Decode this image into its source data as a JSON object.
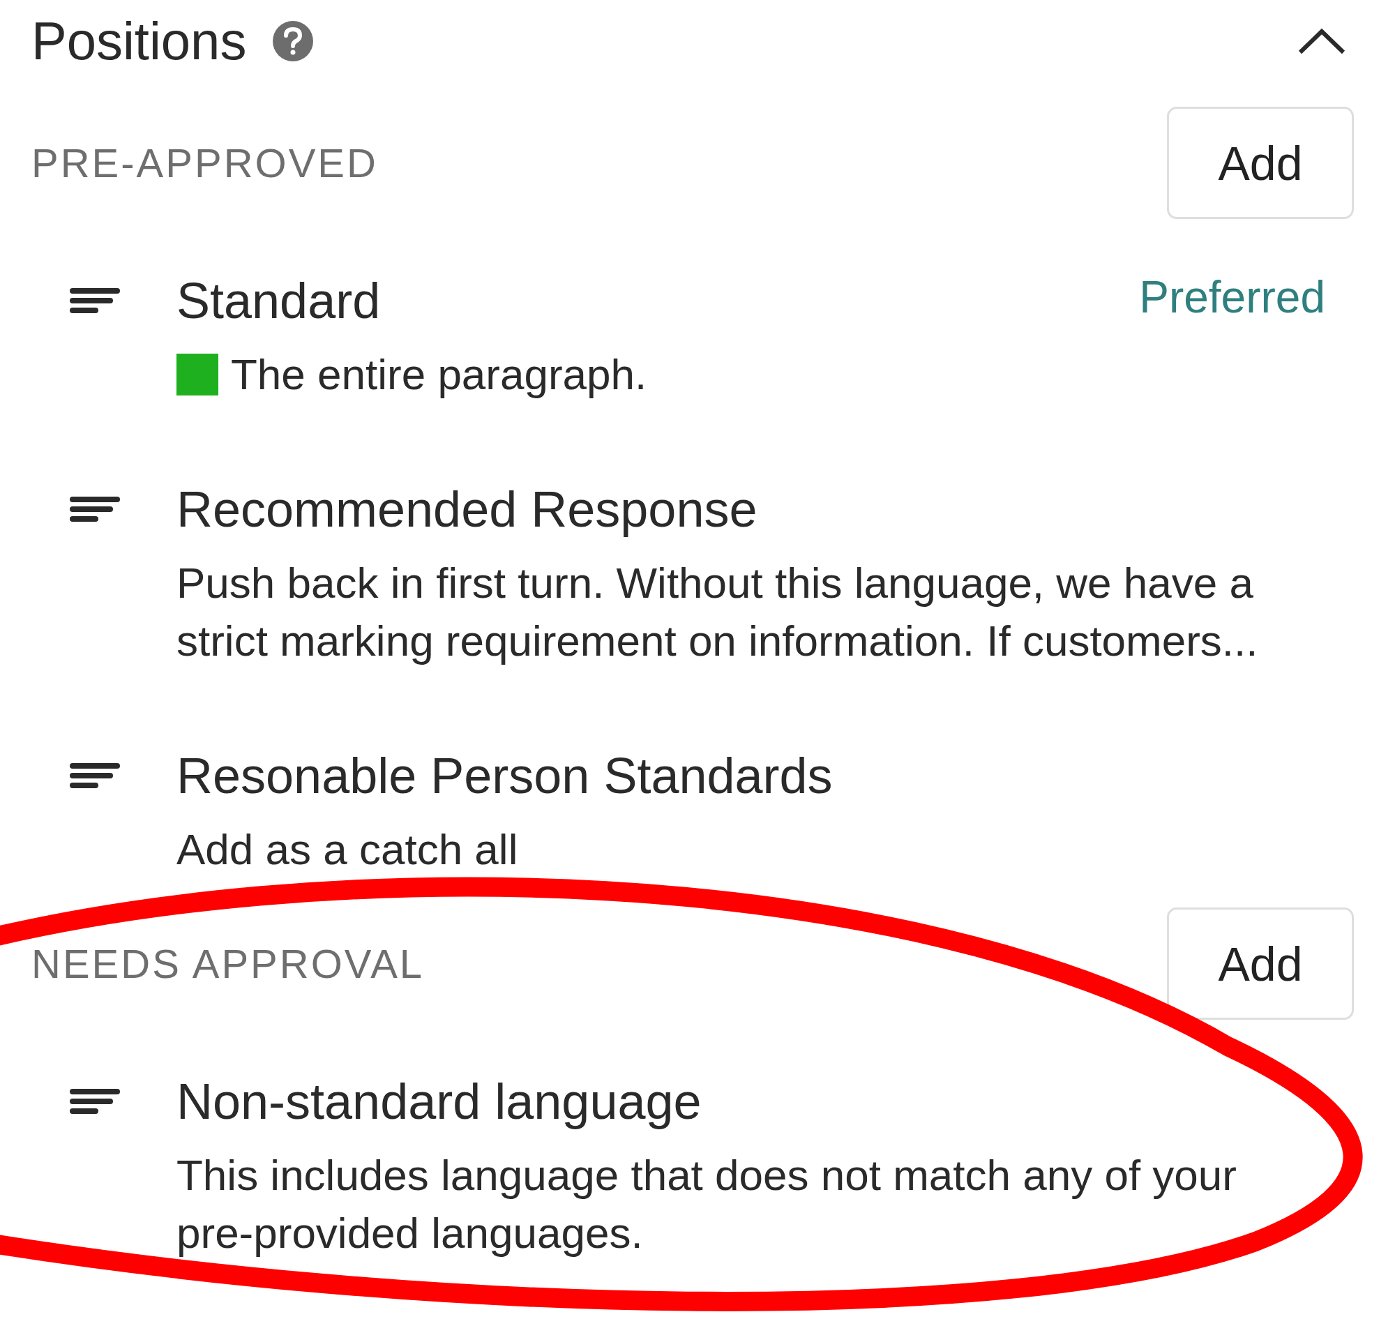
{
  "panel": {
    "title": "Positions",
    "expanded": true
  },
  "sections": [
    {
      "label": "PRE-APPROVED",
      "button": "Add",
      "items": [
        {
          "title": "Standard",
          "badge": "Preferred",
          "color": "#1fb01f",
          "description": "The entire paragraph."
        },
        {
          "title": "Recommended Response",
          "description": "Push back in first turn. Without this language, we have a strict marking requirement on information. If customers..."
        },
        {
          "title": "Resonable Person Standards",
          "description": "Add as a catch all"
        }
      ]
    },
    {
      "label": "NEEDS APPROVAL",
      "button": "Add",
      "items": [
        {
          "title": "Non-standard language",
          "description": "This includes language that does not match any of your pre-provided languages."
        }
      ]
    }
  ]
}
